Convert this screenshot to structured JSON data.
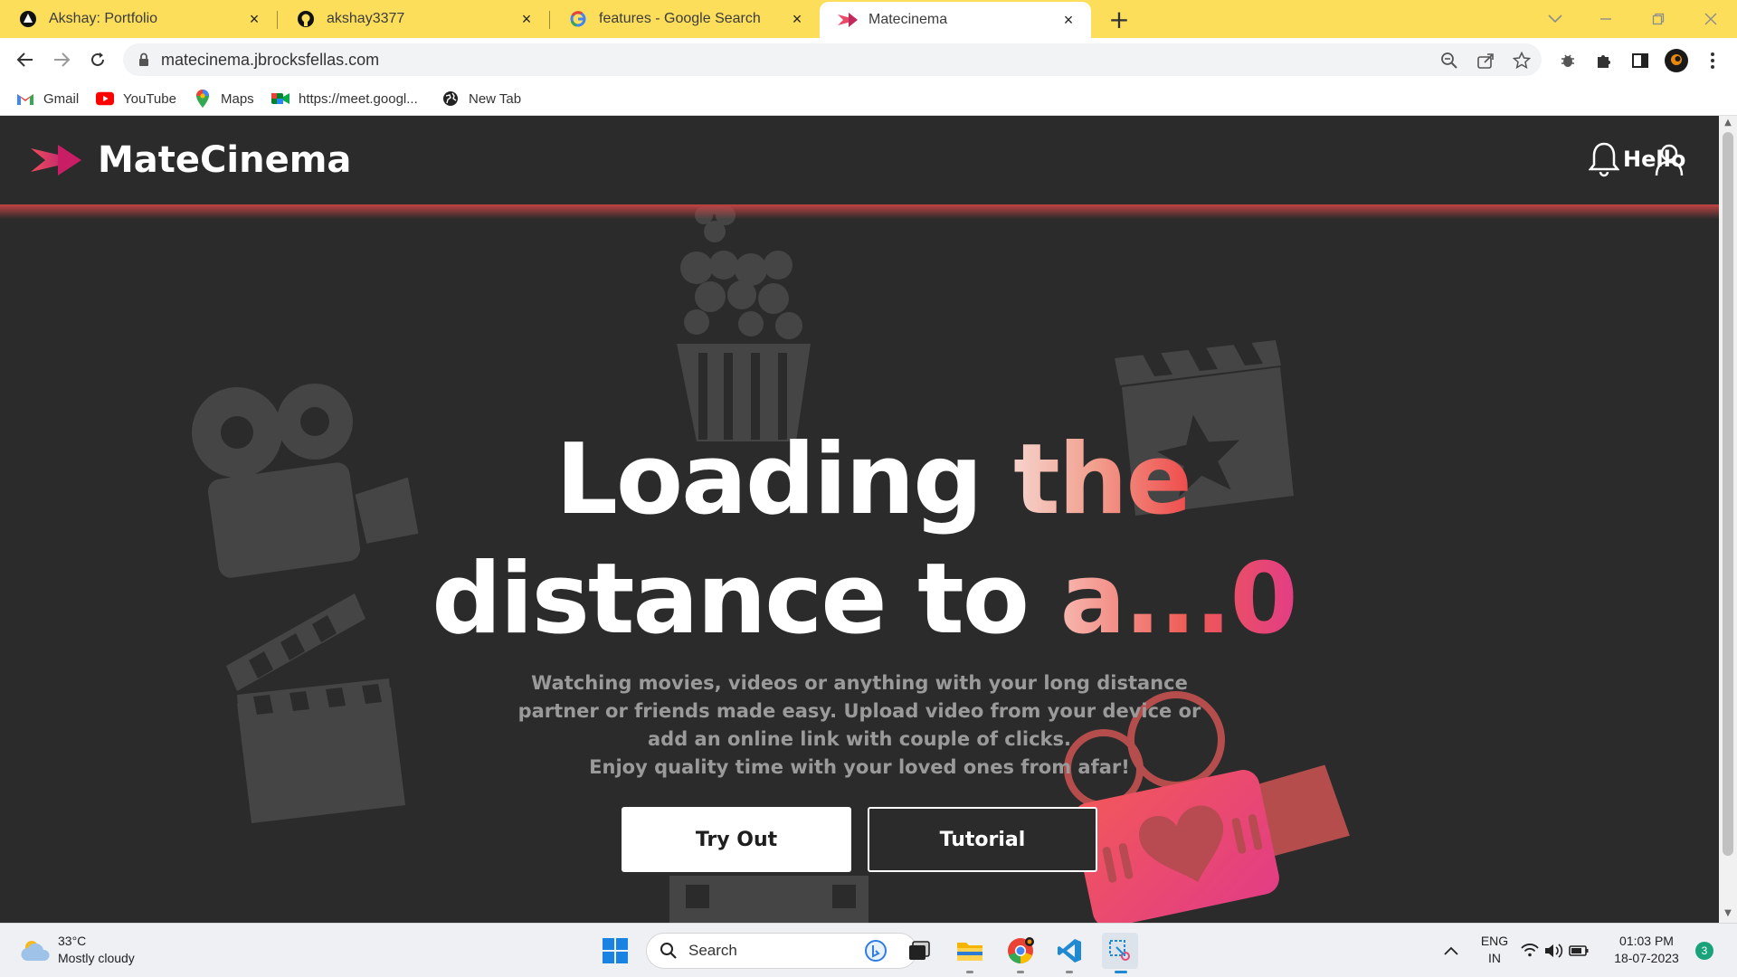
{
  "browser": {
    "tabs": [
      {
        "title": "Akshay: Portfolio",
        "icon": "portfolio-icon"
      },
      {
        "title": "akshay3377",
        "icon": "github-icon"
      },
      {
        "title": "features - Google Search",
        "icon": "google-icon"
      },
      {
        "title": "Matecinema",
        "icon": "matecinema-icon",
        "active": true
      }
    ],
    "close_glyph": "×",
    "new_tab_glyph": "+",
    "url": "matecinema.jbrocksfellas.com",
    "bookmarks": [
      {
        "label": "Gmail",
        "icon": "gmail-icon"
      },
      {
        "label": "YouTube",
        "icon": "youtube-icon"
      },
      {
        "label": "Maps",
        "icon": "maps-icon"
      },
      {
        "label": "https://meet.googl...",
        "icon": "meet-icon"
      },
      {
        "label": "New Tab",
        "icon": "globe-icon"
      }
    ],
    "accent_color": "#fcde5a"
  },
  "site": {
    "brand": "MateCinema",
    "header_hello": "Hello",
    "hero": {
      "line1_white": "Loading ",
      "line1_grad": "the",
      "line2_white": "distance to ",
      "line2_grad": "a...0",
      "subtitle_lines": [
        "Watching movies, videos or anything with your long distance",
        "partner or friends made easy. Upload video from your device or",
        "add an online link with couple of clicks.",
        "Enjoy quality time with your loved ones from afar!"
      ]
    },
    "buttons": {
      "try_out": "Try Out",
      "tutorial": "Tutorial"
    },
    "colors": {
      "background": "#2b2b2b",
      "accent": "#ee4b4b",
      "pink": "#e23d85"
    }
  },
  "taskbar": {
    "weather_temp": "33°C",
    "weather_desc": "Mostly cloudy",
    "search_placeholder": "Search",
    "lang_line1": "ENG",
    "lang_line2": "IN",
    "time": "01:03 PM",
    "date": "18-07-2023",
    "notification_count": "3"
  }
}
